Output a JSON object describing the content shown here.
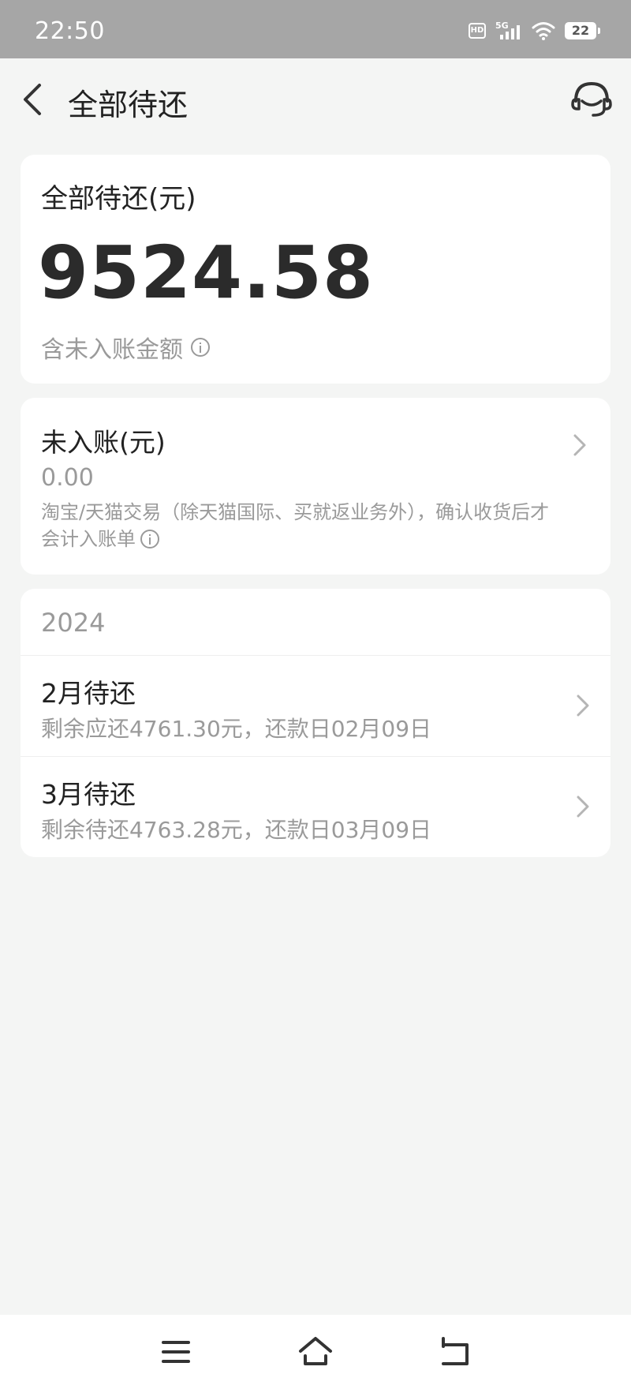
{
  "status_bar": {
    "time": "22:50",
    "hd_badge": "HD",
    "network": "5G",
    "battery": "22",
    "icons": [
      "hd-icon",
      "signal-5g-icon",
      "wifi-icon",
      "battery-icon"
    ]
  },
  "header": {
    "title": "全部待还",
    "back_icon": "chevron-left-icon",
    "service_icon": "customer-service-headset-icon"
  },
  "total_card": {
    "label": "全部待还(元)",
    "amount": "9524.58",
    "note": "含未入账金额",
    "note_icon": "info-icon"
  },
  "unbilled_card": {
    "label": "未入账(元)",
    "value": "0.00",
    "description": "淘宝/天猫交易（除天猫国际、买就返业务外），确认收货后才会计入账单",
    "icon": "info-icon"
  },
  "bills": {
    "year": "2024",
    "items": [
      {
        "title": "2月待还",
        "subtitle": "剩余应还4761.30元，还款日02月09日"
      },
      {
        "title": "3月待还",
        "subtitle": "剩余待还4763.28元，还款日03月09日"
      }
    ]
  },
  "nav_bar": {
    "icons": [
      "menu-icon",
      "home-icon",
      "back-icon"
    ]
  },
  "colors": {
    "background": "#f4f5f4",
    "status_bar": "#a6a6a6",
    "card": "#ffffff",
    "primary_text": "#222222",
    "secondary_text": "#9a9a9a"
  }
}
